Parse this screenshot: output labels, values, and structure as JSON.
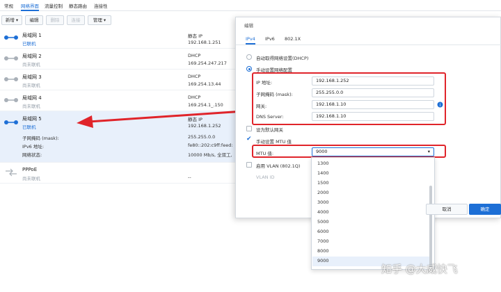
{
  "topnav": {
    "tabs": [
      "常规",
      "网络界面",
      "流量控制",
      "静态路由",
      "连接性"
    ],
    "active_index": 1
  },
  "toolbar": {
    "new_label": "新增",
    "edit_label": "编辑",
    "delete_label": "删除",
    "connect_label": "连接",
    "manage_label": "管理"
  },
  "interfaces": [
    {
      "name": "局域网 1",
      "status": "已联机",
      "type": "静态 IP",
      "ip": "192.168.1.251"
    },
    {
      "name": "局域网 2",
      "status": "尚未联机",
      "type": "DHCP",
      "ip": "169.254.247.217"
    },
    {
      "name": "局域网 3",
      "status": "尚未联机",
      "type": "DHCP",
      "ip": "169.254.13.44"
    },
    {
      "name": "局域网 4",
      "status": "尚未联机",
      "type": "DHCP",
      "ip": "169.254.1_.150"
    },
    {
      "name": "局域网 5",
      "status": "已联机",
      "type": "静态 IP",
      "ip": "192.168.1.252"
    },
    {
      "name": "PPPoE",
      "status": "尚未联机",
      "type": "",
      "ip": "--"
    }
  ],
  "details": {
    "mask_label": "子网掩码 (mask):",
    "mask_value": "255.255.0.0",
    "ipv6_label": "IPv6 地址:",
    "ipv6_value": "fe80::202:c9ff:feed:",
    "netstatus_label": "网络状态:",
    "netstatus_value": "10000 Mb/s, 全双工,"
  },
  "dialog": {
    "title": "编辑",
    "tabs": [
      "IPv4",
      "IPv6",
      "802.1X"
    ],
    "auto_dhcp_label": "自动取得网络设置(DHCP)",
    "manual_label": "手动设置网络配置",
    "ip_label": "IP 地址:",
    "ip_value": "192.168.1.252",
    "mask_label": "子网掩码 (mask):",
    "mask_value": "255.255.0.0",
    "gateway_label": "网关:",
    "gateway_value": "192.168.1.10",
    "dns_label": "DNS Server:",
    "dns_value": "192.168.1.10",
    "default_gw_label": "设为默认网关",
    "mtu_manual_label": "手动设置 MTU 值",
    "mtu_label": "MTU 值:",
    "mtu_value": "9000",
    "vlan_label": "启用 VLAN (802.1Q)",
    "vlan_id_label": "VLAN ID",
    "cancel_label": "取消",
    "ok_label": "确定"
  },
  "mtu_options": [
    "1300",
    "1400",
    "1500",
    "2000",
    "3000",
    "4000",
    "5000",
    "6000",
    "7000",
    "8000",
    "9000"
  ],
  "watermark": "知乎 @大威快飞",
  "colors": {
    "accent": "#1d6fd6",
    "annotation_red": "#e0242a"
  }
}
